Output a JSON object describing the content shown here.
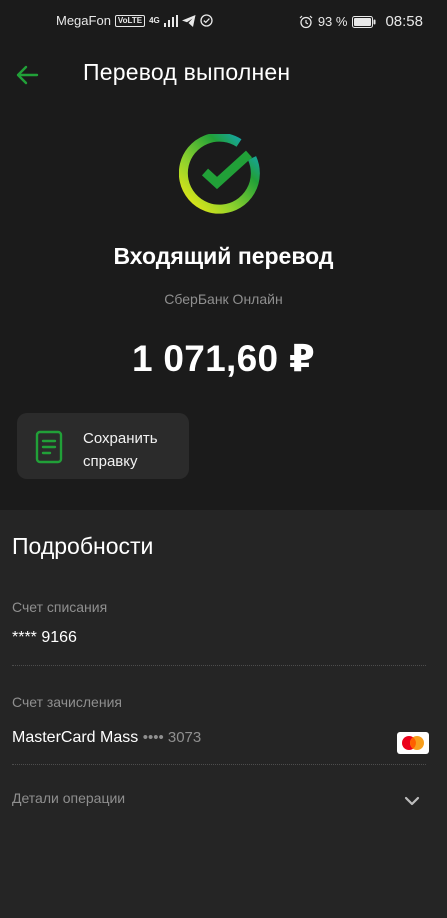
{
  "status": {
    "carrier": "MegaFon",
    "volte": "VoLTE",
    "network": "4G",
    "battery": "93 %",
    "time": "08:58"
  },
  "header": {
    "title": "Перевод выполнен"
  },
  "operation": {
    "title": "Входящий перевод",
    "source": "СберБанк Онлайн",
    "amount": "1 071,60 ₽"
  },
  "actions": {
    "save_receipt": "Сохранить\nсправку"
  },
  "details": {
    "title": "Подробности",
    "debit_label": "Счет списания",
    "debit_value": "**** 9166",
    "credit_label": "Счет зачисления",
    "credit_card_name": "MasterCard Mass",
    "credit_card_mask": "•••• 3073",
    "operation_details": "Детали операции"
  },
  "colors": {
    "accent": "#21a038",
    "background": "#1b1b1b",
    "panel": "#252525"
  },
  "icons": {
    "back": "arrow-left-icon",
    "logo": "sber-check-logo",
    "save": "document-icon",
    "card": "mastercard-icon",
    "expand": "chevron-down-icon"
  }
}
